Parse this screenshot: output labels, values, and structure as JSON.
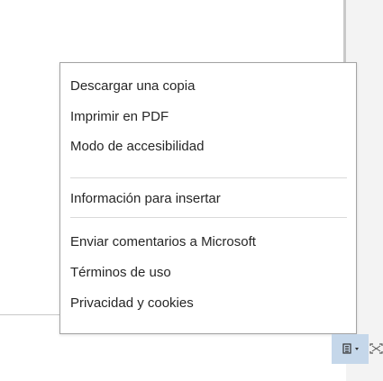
{
  "menu": {
    "items": [
      {
        "label": "Descargar una copia"
      },
      {
        "label": "Imprimir en PDF"
      },
      {
        "label": "Modo de accesibilidad"
      },
      {
        "label": "Información para insertar"
      },
      {
        "label": "Enviar comentarios a Microsoft"
      },
      {
        "label": "Términos de uso"
      },
      {
        "label": "Privacidad y cookies"
      }
    ]
  },
  "toolbar": {
    "menu_button_icon": "document-icon",
    "menu_button_chevron": "chevron-down-icon",
    "fullscreen_icon": "fullscreen-icon",
    "accent_color": "#c5d7ea"
  }
}
